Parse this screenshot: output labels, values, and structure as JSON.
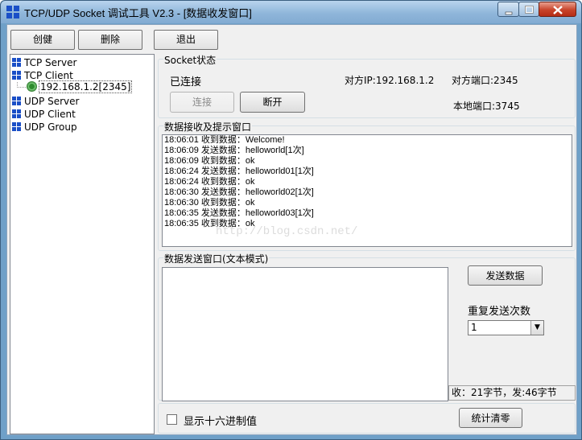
{
  "window": {
    "title": "TCP/UDP Socket 调试工具 V2.3 - [数据收发窗口]"
  },
  "toolbar": {
    "create_label": "创健",
    "delete_label": "删除",
    "exit_label": "退出"
  },
  "tree": {
    "items": [
      {
        "label": "TCP Server"
      },
      {
        "label": "TCP Client"
      },
      {
        "label": "UDP Server"
      },
      {
        "label": "UDP Client"
      },
      {
        "label": "UDP Group"
      }
    ],
    "connection": "192.168.1.2[2345]"
  },
  "socket_status": {
    "title": "Socket状态",
    "state": "已连接",
    "peer_ip": "对方IP:192.168.1.2",
    "peer_port": "对方端口:2345",
    "local_port": "本地端口:3745",
    "connect_label": "连接",
    "disconnect_label": "断开"
  },
  "receive": {
    "title": "数据接收及提示窗口",
    "lines": [
      "18:06:01 收到数据：Welcome!",
      "18:06:09 发送数据：helloworld[1次]",
      "18:06:09 收到数据：ok",
      "18:06:24 发送数据：helloworld01[1次]",
      "18:06:24 收到数据：ok",
      "18:06:30 发送数据：helloworld02[1次]",
      "18:06:30 收到数据：ok",
      "18:06:35 发送数据：helloworld03[1次]",
      "18:06:35 收到数据：ok"
    ],
    "watermark": "http://blog.csdn.net/"
  },
  "send": {
    "title": "数据发送窗口(文本模式)",
    "send_label": "发送数据",
    "repeat_label": "重复发送次数",
    "repeat_value": "1",
    "stats": "收：21字节，发:46字节"
  },
  "bottom": {
    "hex_label": "显示十六进制值",
    "clear_label": "统计清零"
  },
  "colors": {
    "title_gradient_top": "#b9d4ee",
    "tree_icon": "#1a4fc7",
    "close_button": "#c8432a"
  }
}
